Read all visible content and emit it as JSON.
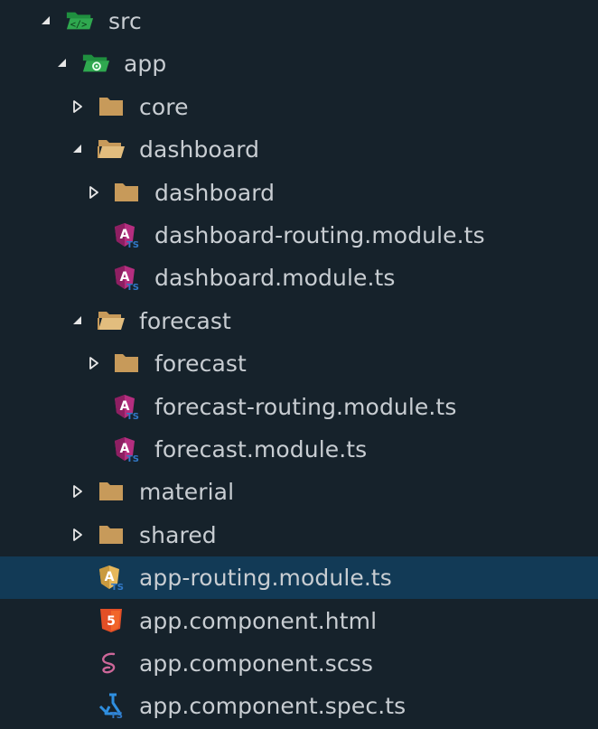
{
  "colors": {
    "background": "#16222b",
    "selected": "#123a56",
    "text": "#c8cdd2",
    "folder": "#c79a5a",
    "angular": "#b52e7f",
    "ts_badge": "#3178c6",
    "html5": "#e34f26",
    "sass": "#cd6799"
  },
  "tree": [
    {
      "label": "src",
      "depth": 0,
      "icon": "folder-src-open-icon",
      "arrow": "expanded"
    },
    {
      "label": "app",
      "depth": 1,
      "icon": "folder-app-open-icon",
      "arrow": "expanded"
    },
    {
      "label": "core",
      "depth": 2,
      "icon": "folder-icon",
      "arrow": "collapsed"
    },
    {
      "label": "dashboard",
      "depth": 2,
      "icon": "folder-open-icon",
      "arrow": "expanded"
    },
    {
      "label": "dashboard",
      "depth": 3,
      "icon": "folder-icon",
      "arrow": "collapsed"
    },
    {
      "label": "dashboard-routing.module.ts",
      "depth": 3,
      "icon": "angular-module-icon",
      "arrow": "none"
    },
    {
      "label": "dashboard.module.ts",
      "depth": 3,
      "icon": "angular-module-icon",
      "arrow": "none"
    },
    {
      "label": "forecast",
      "depth": 2,
      "icon": "folder-open-icon",
      "arrow": "expanded"
    },
    {
      "label": "forecast",
      "depth": 3,
      "icon": "folder-icon",
      "arrow": "collapsed"
    },
    {
      "label": "forecast-routing.module.ts",
      "depth": 3,
      "icon": "angular-module-icon",
      "arrow": "none"
    },
    {
      "label": "forecast.module.ts",
      "depth": 3,
      "icon": "angular-module-icon",
      "arrow": "none"
    },
    {
      "label": "material",
      "depth": 2,
      "icon": "folder-icon",
      "arrow": "collapsed"
    },
    {
      "label": "shared",
      "depth": 2,
      "icon": "folder-icon",
      "arrow": "collapsed"
    },
    {
      "label": "app-routing.module.ts",
      "depth": 2,
      "icon": "angular-routing-icon",
      "arrow": "none",
      "selected": true
    },
    {
      "label": "app.component.html",
      "depth": 2,
      "icon": "html5-icon",
      "arrow": "none"
    },
    {
      "label": "app.component.scss",
      "depth": 2,
      "icon": "sass-icon",
      "arrow": "none"
    },
    {
      "label": "app.component.spec.ts",
      "depth": 2,
      "icon": "test-ts-icon",
      "arrow": "none"
    }
  ]
}
